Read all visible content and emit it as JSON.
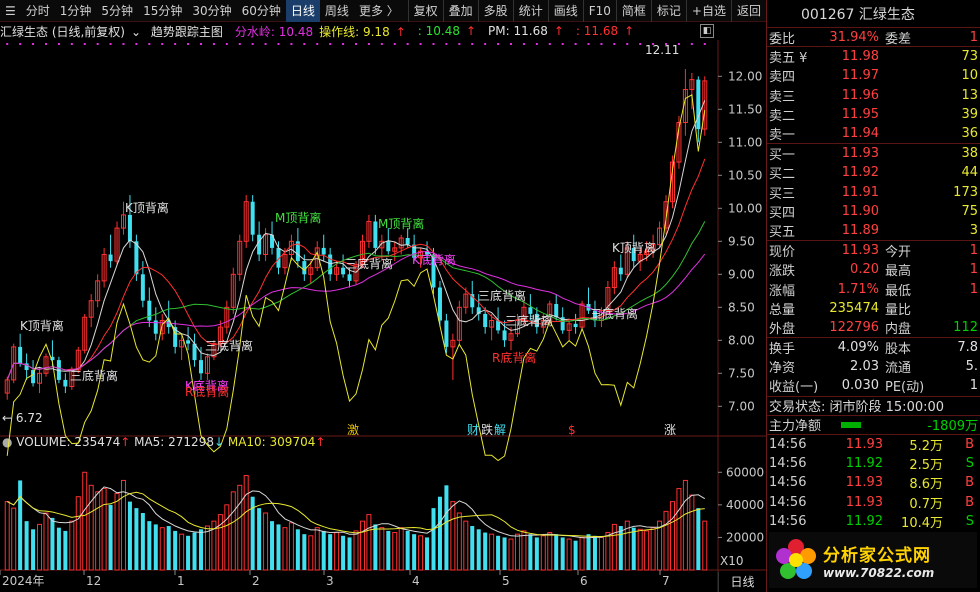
{
  "toolbar": {
    "periods": [
      "分时",
      "1分钟",
      "5分钟",
      "15分钟",
      "30分钟",
      "60分钟",
      "日线",
      "周线",
      "更多 〉"
    ],
    "active": "日线",
    "tools": [
      "复权",
      "叠加",
      "多股",
      "统计",
      "画线",
      "F10",
      "简框",
      "标记",
      "+自选",
      "返回"
    ]
  },
  "info": {
    "stock_label": "汇绿生态 (日线,前复权)",
    "indicator_name": "趋势跟踪主图",
    "fenshuiling": "分水岭: 10.48",
    "caozuoxian": "操作线: 9.18",
    "caozuoxian_arrow": "↑",
    "val3": ": 10.48",
    "val3_arrow": "↑",
    "pm": "PM: 11.68",
    "pm_arrow": "↑",
    "val5": ": 11.68",
    "val5_arrow": "↑"
  },
  "volume_info": {
    "volume": "VOLUME: 235474",
    "volume_arrow": "↑",
    "ma5": "MA5: 271298",
    "ma5_arrow": "↓",
    "ma10": "MA10: 309704",
    "ma10_arrow": "↑"
  },
  "colors": {
    "up": "#ff3030",
    "down": "#40e0f0",
    "yellow": "#e8e830",
    "magenta": "#e030e0",
    "green": "#30c030",
    "white": "#d8d8d8",
    "grid": "#4a0e0e"
  },
  "price_axis": {
    "ticks": [
      "12.00",
      "11.50",
      "11.00",
      "10.50",
      "10.00",
      "9.50",
      "9.00",
      "8.50",
      "8.00",
      "7.50",
      "7.00"
    ],
    "min": 6.55,
    "max": 12.55
  },
  "volume_axis": {
    "ticks": [
      "60000",
      "40000",
      "20000"
    ]
  },
  "time_axis": {
    "labels": [
      "2024年",
      "12",
      "1",
      "2",
      "3",
      "4",
      "5",
      "6",
      "7"
    ]
  },
  "chart_annotations": {
    "high_label": "12.11",
    "low_label": "6.72",
    "pattern_labels": [
      {
        "text": "K顶背离",
        "color": "white"
      },
      {
        "text": "三底背离",
        "color": "white"
      },
      {
        "text": "K顶背离",
        "color": "white"
      },
      {
        "text": "三底背离",
        "color": "white"
      },
      {
        "text": "K底背离",
        "color": "magenta"
      },
      {
        "text": "R底背离",
        "color": "red"
      },
      {
        "text": "M顶背离",
        "color": "green"
      },
      {
        "text": "三底背离",
        "color": "white"
      },
      {
        "text": "M顶背离",
        "color": "green"
      },
      {
        "text": "K底背离",
        "color": "magenta"
      },
      {
        "text": "三底背离",
        "color": "white"
      },
      {
        "text": "三底背离",
        "color": "white"
      },
      {
        "text": "R底背离",
        "color": "red"
      },
      {
        "text": "三底背离",
        "color": "white"
      },
      {
        "text": "K顶背离",
        "color": "white"
      }
    ],
    "event_markers": [
      {
        "text": "激",
        "color": "yellow"
      },
      {
        "text": "财",
        "color": "cyan"
      },
      {
        "text": "跌",
        "color": "white"
      },
      {
        "text": "解",
        "color": "cyan"
      },
      {
        "text": "$",
        "color": "red"
      },
      {
        "text": "涨",
        "color": "white"
      }
    ]
  },
  "chart_data": {
    "type": "candlestick",
    "note_x": "daily candles Nov 2024 – Jul 2025",
    "ohlc": [
      [
        7.2,
        7.45,
        7.1,
        7.4
      ],
      [
        7.4,
        7.95,
        7.35,
        7.9
      ],
      [
        7.9,
        8.1,
        7.6,
        7.65
      ],
      [
        7.65,
        7.8,
        7.4,
        7.55
      ],
      [
        7.55,
        7.7,
        7.3,
        7.35
      ],
      [
        7.35,
        7.6,
        7.2,
        7.5
      ],
      [
        7.5,
        7.8,
        7.45,
        7.75
      ],
      [
        7.75,
        8.0,
        7.6,
        7.7
      ],
      [
        7.7,
        7.75,
        7.35,
        7.4
      ],
      [
        7.4,
        7.5,
        7.2,
        7.3
      ],
      [
        7.3,
        7.6,
        7.25,
        7.55
      ],
      [
        7.55,
        7.9,
        7.5,
        7.85
      ],
      [
        7.85,
        8.4,
        7.8,
        8.35
      ],
      [
        8.35,
        8.7,
        8.2,
        8.6
      ],
      [
        8.6,
        9.0,
        8.5,
        8.9
      ],
      [
        8.9,
        9.4,
        8.8,
        9.3
      ],
      [
        9.3,
        9.6,
        9.1,
        9.2
      ],
      [
        9.2,
        9.8,
        9.15,
        9.7
      ],
      [
        9.7,
        10.1,
        9.6,
        9.9
      ],
      [
        9.9,
        10.2,
        9.4,
        9.5
      ],
      [
        9.5,
        9.6,
        8.9,
        9.0
      ],
      [
        9.0,
        9.2,
        8.5,
        8.6
      ],
      [
        8.6,
        8.8,
        8.2,
        8.3
      ],
      [
        8.3,
        8.5,
        8.0,
        8.1
      ],
      [
        8.1,
        8.4,
        8.0,
        8.3
      ],
      [
        8.3,
        8.6,
        8.1,
        8.2
      ],
      [
        8.2,
        8.3,
        7.8,
        7.9
      ],
      [
        7.9,
        8.1,
        7.7,
        8.0
      ],
      [
        8.0,
        8.2,
        7.85,
        7.95
      ],
      [
        7.95,
        8.1,
        7.6,
        7.7
      ],
      [
        7.7,
        7.9,
        7.4,
        7.5
      ],
      [
        7.5,
        7.8,
        7.4,
        7.75
      ],
      [
        7.75,
        8.0,
        7.7,
        7.95
      ],
      [
        7.95,
        8.3,
        7.9,
        8.2
      ],
      [
        8.2,
        8.6,
        8.1,
        8.5
      ],
      [
        8.5,
        9.1,
        8.4,
        9.0
      ],
      [
        9.0,
        9.6,
        8.9,
        9.5
      ],
      [
        9.5,
        10.2,
        9.4,
        10.1
      ],
      [
        10.1,
        10.2,
        9.5,
        9.6
      ],
      [
        9.6,
        9.8,
        9.2,
        9.3
      ],
      [
        9.3,
        9.7,
        9.2,
        9.6
      ],
      [
        9.6,
        9.8,
        9.3,
        9.4
      ],
      [
        9.4,
        9.5,
        9.0,
        9.1
      ],
      [
        9.1,
        9.4,
        9.0,
        9.3
      ],
      [
        9.3,
        9.6,
        9.2,
        9.5
      ],
      [
        9.5,
        9.7,
        9.1,
        9.2
      ],
      [
        9.2,
        9.3,
        8.9,
        9.0
      ],
      [
        9.0,
        9.2,
        8.85,
        9.1
      ],
      [
        9.1,
        9.5,
        9.05,
        9.4
      ],
      [
        9.4,
        9.6,
        9.2,
        9.3
      ],
      [
        9.3,
        9.4,
        8.9,
        9.0
      ],
      [
        9.0,
        9.2,
        8.9,
        9.1
      ],
      [
        9.1,
        9.3,
        8.95,
        9.0
      ],
      [
        9.0,
        9.1,
        8.8,
        8.9
      ],
      [
        8.9,
        9.2,
        8.85,
        9.15
      ],
      [
        9.15,
        9.6,
        9.1,
        9.5
      ],
      [
        9.5,
        9.9,
        9.4,
        9.8
      ],
      [
        9.8,
        9.9,
        9.3,
        9.4
      ],
      [
        9.4,
        9.6,
        9.2,
        9.5
      ],
      [
        9.5,
        9.7,
        9.3,
        9.35
      ],
      [
        9.35,
        9.5,
        9.2,
        9.4
      ],
      [
        9.4,
        9.6,
        9.3,
        9.55
      ],
      [
        9.55,
        9.7,
        9.4,
        9.45
      ],
      [
        9.45,
        9.6,
        9.2,
        9.25
      ],
      [
        9.25,
        9.4,
        9.1,
        9.35
      ],
      [
        9.35,
        9.5,
        9.2,
        9.3
      ],
      [
        9.3,
        9.4,
        8.7,
        8.8
      ],
      [
        8.8,
        8.9,
        8.2,
        8.3
      ],
      [
        8.3,
        8.4,
        7.8,
        7.9
      ],
      [
        7.9,
        8.1,
        7.4,
        8.0
      ],
      [
        8.0,
        8.6,
        7.95,
        8.5
      ],
      [
        8.5,
        8.8,
        8.4,
        8.7
      ],
      [
        8.7,
        8.9,
        8.4,
        8.5
      ],
      [
        8.5,
        8.7,
        8.3,
        8.4
      ],
      [
        8.4,
        8.5,
        8.1,
        8.2
      ],
      [
        8.2,
        8.4,
        8.0,
        8.3
      ],
      [
        8.3,
        8.5,
        8.1,
        8.15
      ],
      [
        8.15,
        8.3,
        7.9,
        8.0
      ],
      [
        8.0,
        8.2,
        7.85,
        8.1
      ],
      [
        8.1,
        8.4,
        8.05,
        8.3
      ],
      [
        8.3,
        8.6,
        8.2,
        8.5
      ],
      [
        8.5,
        8.7,
        8.3,
        8.4
      ],
      [
        8.4,
        8.5,
        8.1,
        8.2
      ],
      [
        8.2,
        8.4,
        8.1,
        8.3
      ],
      [
        8.3,
        8.6,
        8.25,
        8.55
      ],
      [
        8.55,
        8.7,
        8.3,
        8.35
      ],
      [
        8.35,
        8.5,
        8.1,
        8.15
      ],
      [
        8.15,
        8.3,
        8.0,
        8.25
      ],
      [
        8.25,
        8.4,
        8.1,
        8.2
      ],
      [
        8.2,
        8.6,
        8.15,
        8.55
      ],
      [
        8.55,
        8.8,
        8.4,
        8.45
      ],
      [
        8.45,
        8.6,
        8.2,
        8.3
      ],
      [
        8.3,
        8.5,
        8.2,
        8.45
      ],
      [
        8.45,
        8.9,
        8.4,
        8.8
      ],
      [
        8.8,
        9.2,
        8.7,
        9.1
      ],
      [
        9.1,
        9.3,
        8.9,
        9.0
      ],
      [
        9.0,
        9.5,
        8.95,
        9.4
      ],
      [
        9.4,
        9.6,
        9.1,
        9.2
      ],
      [
        9.2,
        9.4,
        9.05,
        9.3
      ],
      [
        9.3,
        9.5,
        9.2,
        9.35
      ],
      [
        9.35,
        9.6,
        9.25,
        9.45
      ],
      [
        9.45,
        9.8,
        9.4,
        9.7
      ],
      [
        9.7,
        10.2,
        9.6,
        10.1
      ],
      [
        10.1,
        10.8,
        10.0,
        10.7
      ],
      [
        10.7,
        11.4,
        10.6,
        11.3
      ],
      [
        11.3,
        12.11,
        11.1,
        11.8
      ],
      [
        11.8,
        12.05,
        11.5,
        11.95
      ],
      [
        11.95,
        12.0,
        11.0,
        11.2
      ],
      [
        11.2,
        12.0,
        11.1,
        11.93
      ]
    ],
    "volume": [
      42000,
      38000,
      55000,
      30000,
      25000,
      28000,
      35000,
      32000,
      26000,
      24000,
      30000,
      45000,
      60000,
      52000,
      48000,
      50000,
      40000,
      47000,
      55000,
      42000,
      38000,
      35000,
      30000,
      28000,
      26000,
      27000,
      24000,
      22000,
      21000,
      23000,
      25000,
      27000,
      30000,
      34000,
      40000,
      48000,
      52000,
      58000,
      45000,
      38000,
      35000,
      30000,
      28000,
      26000,
      29000,
      25000,
      22000,
      21000,
      26000,
      24000,
      22000,
      23000,
      21000,
      20000,
      24000,
      30000,
      34000,
      28000,
      26000,
      24000,
      23000,
      26000,
      24000,
      22000,
      21000,
      20000,
      38000,
      45000,
      52000,
      42000,
      35000,
      30000,
      27000,
      25000,
      23000,
      22000,
      21000,
      20000,
      19000,
      22000,
      24000,
      22000,
      20000,
      21000,
      23000,
      22000,
      20000,
      19000,
      18000,
      20000,
      22000,
      21000,
      20000,
      23000,
      28000,
      27000,
      30000,
      26000,
      25000,
      24000,
      26000,
      30000,
      36000,
      42000,
      50000,
      55000,
      46000,
      38000,
      30000
    ]
  },
  "quote": {
    "title": "001267 汇绿生态",
    "weibi_label": "委比",
    "weibi": "31.94%",
    "weicha_label": "委差",
    "weicha": "1",
    "asks": [
      {
        "label": "卖五 ¥",
        "price": "11.98",
        "vol": "73"
      },
      {
        "label": "卖四",
        "price": "11.97",
        "vol": "10"
      },
      {
        "label": "卖三",
        "price": "11.96",
        "vol": "13"
      },
      {
        "label": "卖二",
        "price": "11.95",
        "vol": "39"
      },
      {
        "label": "卖一",
        "price": "11.94",
        "vol": "36"
      }
    ],
    "bids": [
      {
        "label": "买一",
        "price": "11.93",
        "vol": "38"
      },
      {
        "label": "买二",
        "price": "11.92",
        "vol": "44"
      },
      {
        "label": "买三",
        "price": "11.91",
        "vol": "173"
      },
      {
        "label": "买四",
        "price": "11.90",
        "vol": "75"
      },
      {
        "label": "买五",
        "price": "11.89",
        "vol": "3"
      }
    ],
    "stats": [
      {
        "l1": "现价",
        "v1": "11.93",
        "c1": "red",
        "l2": "今开",
        "v2": "1",
        "c2": "red"
      },
      {
        "l1": "涨跌",
        "v1": "0.20",
        "c1": "red",
        "l2": "最高",
        "v2": "1",
        "c2": "red"
      },
      {
        "l1": "涨幅",
        "v1": "1.71%",
        "c1": "red",
        "l2": "最低",
        "v2": "1",
        "c2": "red"
      },
      {
        "l1": "总量",
        "v1": "235474",
        "c1": "yel",
        "l2": "量比",
        "v2": "",
        "c2": "white"
      },
      {
        "l1": "外盘",
        "v1": "122796",
        "c1": "red",
        "l2": "内盘",
        "v2": "112",
        "c2": "green"
      }
    ],
    "stats2": [
      {
        "l1": "换手",
        "v1": "4.09%",
        "l2": "股本",
        "v2": "7.8"
      },
      {
        "l1": "净资",
        "v1": "2.03",
        "l2": "流通",
        "v2": "5."
      },
      {
        "l1": "收益(一)",
        "v1": "0.030",
        "l2": "PE(动)",
        "v2": "1"
      }
    ],
    "trade_status": "交易状态: 闭市阶段 15:00:00",
    "main_net_label": "主力净额",
    "main_net": "-1809万",
    "ticks": [
      {
        "t": "14:56",
        "p": "11.93",
        "v": "5.2万",
        "bs": "B",
        "c": "red"
      },
      {
        "t": "14:56",
        "p": "11.92",
        "v": "2.5万",
        "bs": "S",
        "c": "green"
      },
      {
        "t": "14:56",
        "p": "11.93",
        "v": "8.6万",
        "bs": "B",
        "c": "red"
      },
      {
        "t": "14:56",
        "p": "11.93",
        "v": "0.7万",
        "bs": "B",
        "c": "red"
      },
      {
        "t": "14:56",
        "p": "11.92",
        "v": "10.4万",
        "bs": "S",
        "c": "green"
      }
    ]
  },
  "logo": {
    "cn": "分析家公式网",
    "url": "www.70822.com"
  },
  "x10": "X10",
  "bottom_tab": "日线"
}
